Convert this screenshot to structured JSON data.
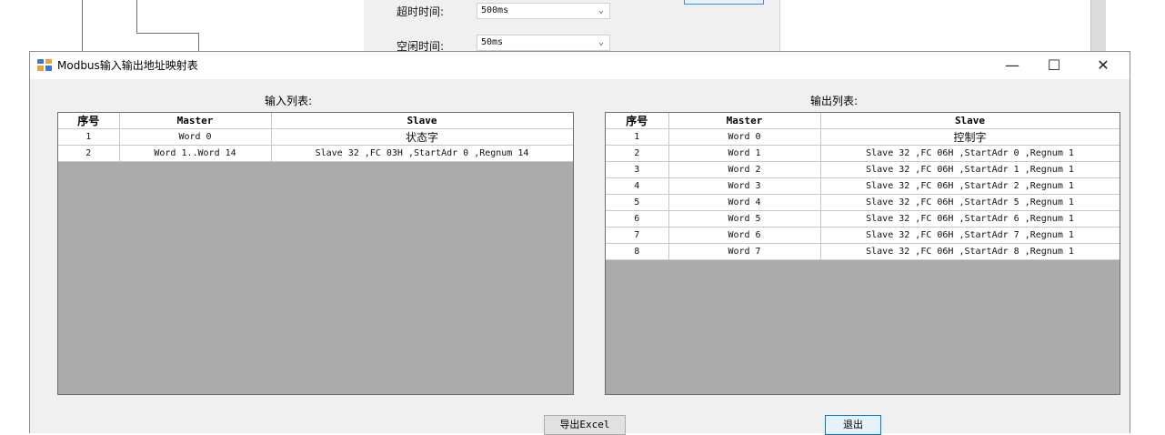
{
  "background_form": {
    "timeout_label": "超时时间:",
    "timeout_value": "500ms",
    "idle_label": "空闲时间:",
    "idle_value": "50ms"
  },
  "window": {
    "title": "Modbus输入输出地址映射表",
    "minimize_glyph": "—",
    "maximize_glyph": "☐",
    "close_glyph": "✕"
  },
  "input_table": {
    "title": "输入列表:",
    "headers": [
      "序号",
      "Master",
      "Slave"
    ],
    "rows": [
      [
        "1",
        "Word 0",
        "状态字"
      ],
      [
        "2",
        "Word 1..Word 14",
        "Slave 32 ,FC 03H ,StartAdr 0 ,Regnum 14"
      ]
    ]
  },
  "output_table": {
    "title": "输出列表:",
    "headers": [
      "序号",
      "Master",
      "Slave"
    ],
    "rows": [
      [
        "1",
        "Word 0",
        "控制字"
      ],
      [
        "2",
        "Word 1",
        "Slave 32 ,FC 06H ,StartAdr 0 ,Regnum 1"
      ],
      [
        "3",
        "Word 2",
        "Slave 32 ,FC 06H ,StartAdr 1 ,Regnum 1"
      ],
      [
        "4",
        "Word 3",
        "Slave 32 ,FC 06H ,StartAdr 2 ,Regnum 1"
      ],
      [
        "5",
        "Word 4",
        "Slave 32 ,FC 06H ,StartAdr 5 ,Regnum 1"
      ],
      [
        "6",
        "Word 5",
        "Slave 32 ,FC 06H ,StartAdr 6 ,Regnum 1"
      ],
      [
        "7",
        "Word 6",
        "Slave 32 ,FC 06H ,StartAdr 7 ,Regnum 1"
      ],
      [
        "8",
        "Word 7",
        "Slave 32 ,FC 06H ,StartAdr 8 ,Regnum 1"
      ]
    ]
  },
  "buttons": {
    "export_label": "导出Excel",
    "exit_label": "退出"
  },
  "colors": {
    "grid_empty": "#ababab",
    "dialog_bg": "#f0f0f0",
    "focus_border": "#0078d7"
  }
}
